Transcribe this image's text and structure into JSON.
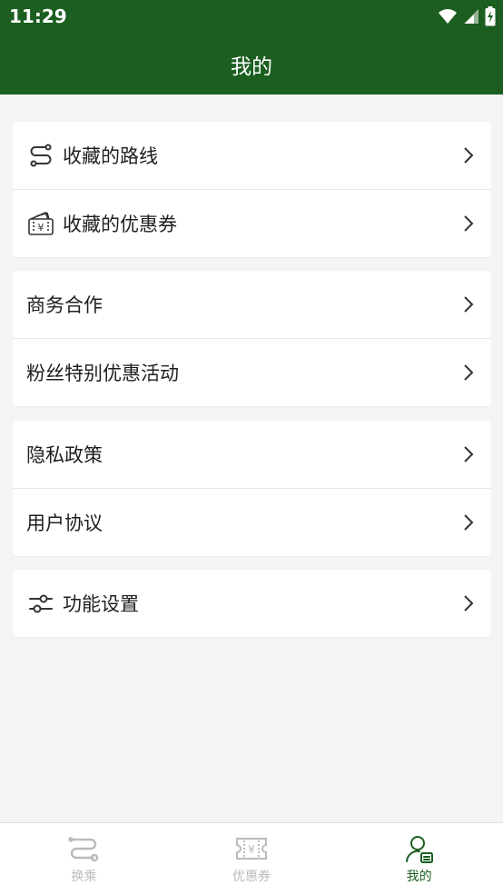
{
  "status_bar": {
    "time": "11:29"
  },
  "header": {
    "title": "我的"
  },
  "groups": [
    {
      "items": [
        {
          "label": "收藏的路线",
          "icon": "route-icon"
        },
        {
          "label": "收藏的优惠券",
          "icon": "coupon-wallet-icon"
        }
      ]
    },
    {
      "items": [
        {
          "label": "商务合作"
        },
        {
          "label": "粉丝特别优惠活动"
        }
      ]
    },
    {
      "items": [
        {
          "label": "隐私政策"
        },
        {
          "label": "用户协议"
        }
      ]
    },
    {
      "items": [
        {
          "label": "功能设置",
          "icon": "sliders-icon"
        }
      ]
    }
  ],
  "bottom_nav": {
    "tabs": [
      {
        "label": "换乘",
        "icon": "transfer-icon"
      },
      {
        "label": "优惠券",
        "icon": "ticket-icon"
      },
      {
        "label": "我的",
        "icon": "profile-icon",
        "active": true
      }
    ]
  },
  "colors": {
    "brand": "#1b5e20",
    "background": "#f4f4f4",
    "inactive": "#bbbbbb"
  }
}
